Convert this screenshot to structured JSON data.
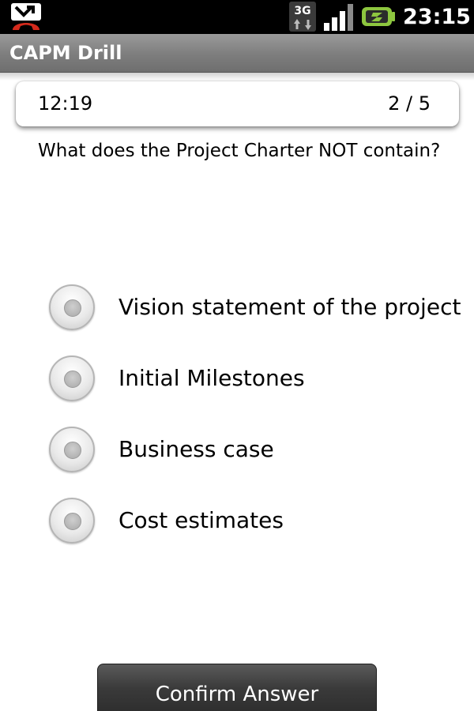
{
  "status_bar": {
    "time": "23:15",
    "network_type": "3G",
    "icons": [
      "missed-call-icon",
      "3g-data-icon",
      "signal-strength-icon",
      "battery-icon"
    ]
  },
  "app": {
    "title": "CAPM Drill"
  },
  "quiz": {
    "timer": "12:19",
    "progress": "2 / 5",
    "question": "What does the Project Charter NOT contain?",
    "options": [
      {
        "label": "Vision statement of the project",
        "selected": false
      },
      {
        "label": "Initial Milestones",
        "selected": false
      },
      {
        "label": "Business case",
        "selected": false
      },
      {
        "label": "Cost estimates",
        "selected": false
      }
    ],
    "confirm_label": "Confirm Answer"
  },
  "colors": {
    "status_bar_bg": "#000000",
    "title_bar_bg": "#7d7d7d",
    "button_bg": "#3a3a3a",
    "missed_call_red": "#d42a1c"
  }
}
